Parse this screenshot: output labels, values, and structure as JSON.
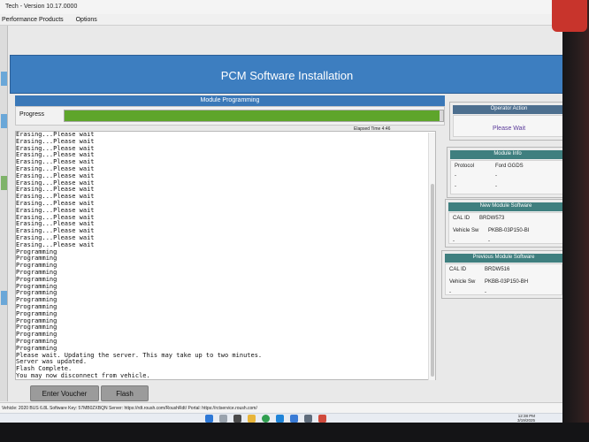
{
  "window": {
    "title": "Tech - Version 10.17.0000"
  },
  "menu": {
    "items": [
      "Performance Products",
      "Options"
    ]
  },
  "banner": {
    "title": "PCM Software Installation"
  },
  "module": {
    "header": "Module Programming",
    "progress_label": "Progress",
    "progress_fraction": 0.99,
    "elapsed": "Elapsed Time 4:46"
  },
  "log": {
    "lines": [
      "Erasing...Please wait",
      "Erasing...Please wait",
      "Erasing...Please wait",
      "Erasing...Please wait",
      "Erasing...Please wait",
      "Erasing...Please wait",
      "Erasing...Please wait",
      "Erasing...Please wait",
      "Erasing...Please wait",
      "Erasing...Please wait",
      "Erasing...Please wait",
      "Erasing...Please wait",
      "Erasing...Please wait",
      "Erasing...Please wait",
      "Erasing...Please wait",
      "Erasing...Please wait",
      "Erasing...Please wait",
      "Programming",
      "Programming",
      "Programming",
      "Programming",
      "Programming",
      "Programming",
      "Programming",
      "Programming",
      "Programming",
      "Programming",
      "Programming",
      "Programming",
      "Programming",
      "Programming",
      "Programming",
      "Please wait. Updating the server. This may take up to two minutes.",
      "Server was updated.",
      "Flash Complete.",
      "You may now disconnect from vehicle."
    ]
  },
  "buttons": {
    "enter_voucher": "Enter Voucher",
    "flash": "Flash"
  },
  "operator_action": {
    "header": "Operator Action",
    "message": "Please Wait"
  },
  "module_info": {
    "header": "Module Info",
    "protocol_label": "Protocol",
    "protocol_value": "Ford GGDS",
    "dash1": "-",
    "dash2": "-",
    "dash3": "-",
    "dash4": "-"
  },
  "new_software": {
    "header": "New Module Software",
    "cal_label": "CAL ID",
    "cal_value": "BRDW573",
    "sw_label": "Vehicle Sw",
    "sw_value": "PKBB-03P150-BI",
    "dash1": "-",
    "dash2": "-"
  },
  "previous_software": {
    "header": "Previous Module Software",
    "cal_label": "CAL ID",
    "cal_value": "BRDW516",
    "sw_label": "Vehicle Sw",
    "sw_value": "PKBB-03P150-BH",
    "dash1": "-",
    "dash2": "-"
  },
  "status": {
    "text": "Vehicle: 2020 BUS 6.8L Software Key: 57MB0ZXBQN  Server: https://rdt.roush.com/RoushRdt/  Portal: https://rctservice.roush.com/"
  },
  "tray": {
    "time": "12:38 PM",
    "date": "3/19/2025"
  },
  "colors": {
    "banner_blue": "#3d7ec0",
    "progress_green": "#5ea52b",
    "panel_teal": "#3f7f7f",
    "operator_text": "#5b3b9a"
  }
}
